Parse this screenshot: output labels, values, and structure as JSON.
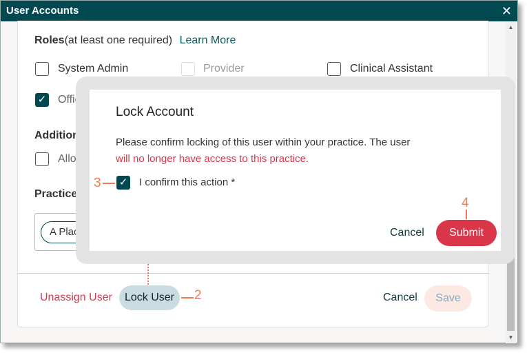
{
  "window": {
    "title": "User Accounts",
    "close_icon": "close-icon"
  },
  "roles": {
    "label": "Roles",
    "hint": "(at least one required)",
    "learn_more": "Learn More",
    "items": [
      {
        "label": "System Admin",
        "checked": false
      },
      {
        "label": "Provider",
        "checked": false,
        "disabled": true
      },
      {
        "label": "Clinical Assistant",
        "checked": false
      },
      {
        "label": "Office",
        "checked": true
      }
    ]
  },
  "additional": {
    "label": "Additional",
    "item": "Allow"
  },
  "practice": {
    "label": "Practice Ac",
    "chip": "A Place f"
  },
  "footer": {
    "unassign": "Unassign User",
    "lock": "Lock User",
    "cancel": "Cancel",
    "save": "Save"
  },
  "dialog": {
    "title": "Lock Account",
    "message1": "Please confirm locking of this user within your practice. The user",
    "message2": "will no longer have access to this practice.",
    "confirm_label": "I confirm this action *",
    "confirm_checked": true,
    "cancel": "Cancel",
    "submit": "Submit"
  },
  "annotations": {
    "a2": "2",
    "a3": "3",
    "a4": "4"
  },
  "colors": {
    "brand": "#024850",
    "danger": "#d9364a",
    "annotation": "#f47a50"
  }
}
